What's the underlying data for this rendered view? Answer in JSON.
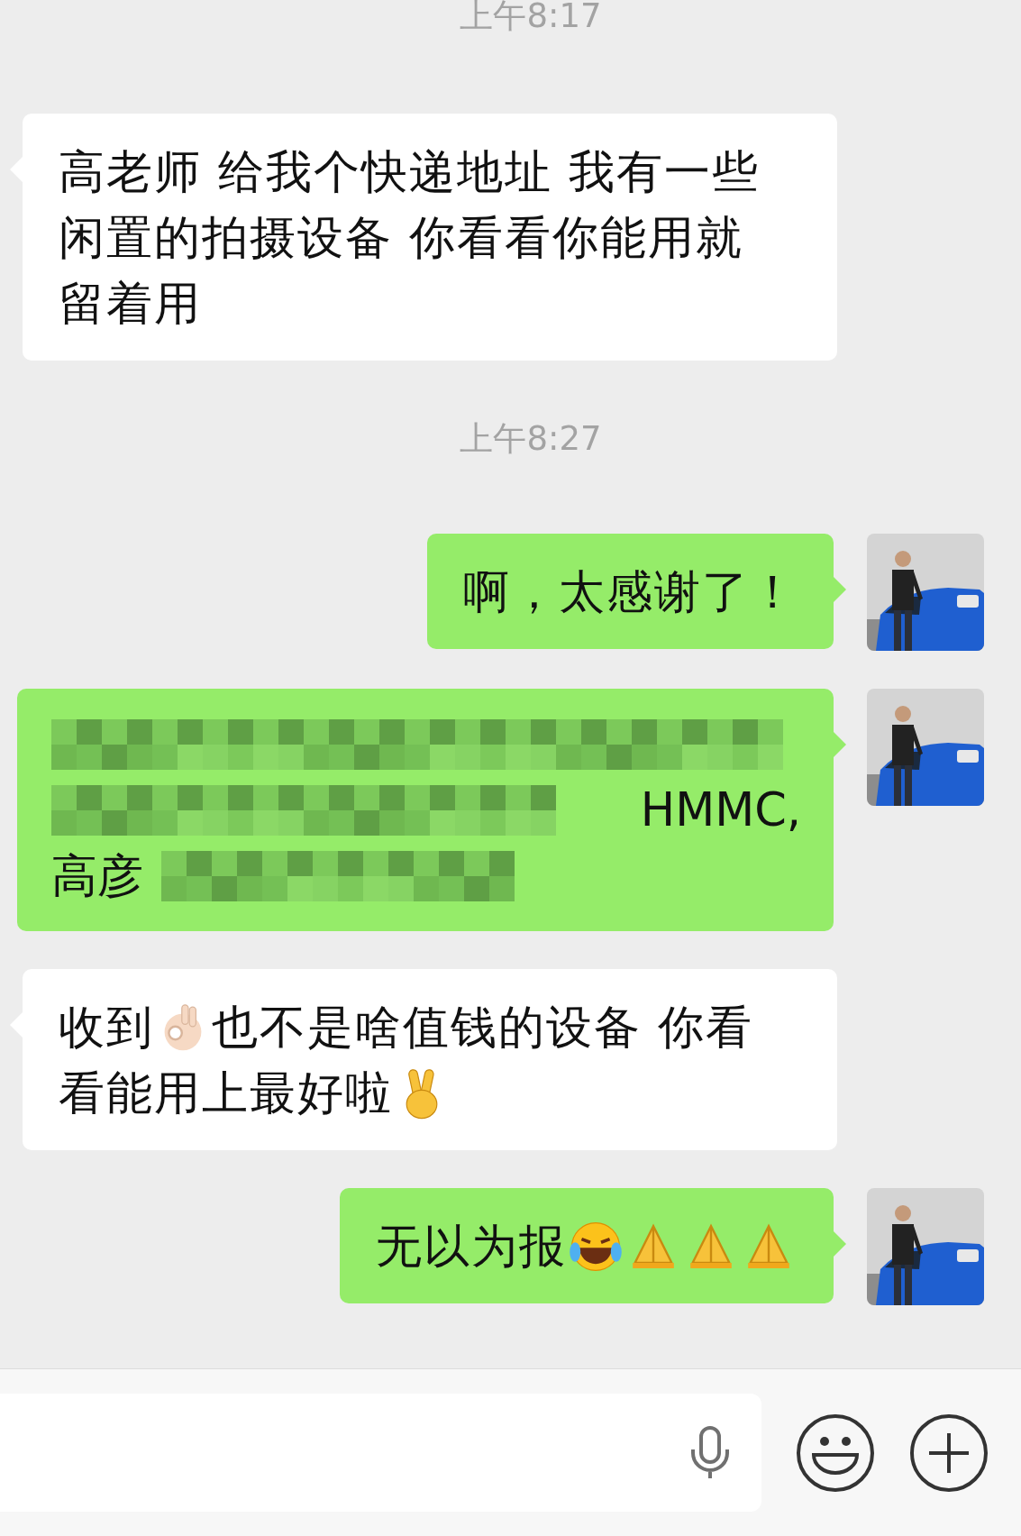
{
  "messages": [
    {
      "kind": "time",
      "text": "上午8:17"
    },
    {
      "kind": "received",
      "lines": [
        [
          {
            "kind": "text",
            "text": "高老师 给我个快递地址 我有一些"
          }
        ],
        [
          {
            "kind": "text",
            "text": "闲置的拍摄设备 你看看你能用就"
          }
        ],
        [
          {
            "kind": "text",
            "text": "留着用"
          }
        ]
      ]
    },
    {
      "kind": "time",
      "text": "上午8:27"
    },
    {
      "kind": "sent",
      "lines": [
        [
          {
            "kind": "text",
            "text": "啊，太感谢了！"
          }
        ]
      ]
    },
    {
      "kind": "redacted",
      "line_2_end": "HMMC,",
      "line_3_start": "高彦"
    },
    {
      "kind": "received",
      "lines": [
        [
          {
            "kind": "text",
            "text": "收到"
          },
          {
            "kind": "ok_hand"
          },
          {
            "kind": "text",
            "text": "也不是啥值钱的设备 你看"
          }
        ],
        [
          {
            "kind": "text",
            "text": "看能用上最好啦"
          },
          {
            "kind": "victory_hand"
          }
        ]
      ]
    },
    {
      "kind": "sent",
      "lines": [
        [
          {
            "kind": "text",
            "text": "无以为报"
          },
          {
            "kind": "laugh_cry"
          },
          {
            "kind": "folded_hands"
          },
          {
            "kind": "folded_hands"
          },
          {
            "kind": "folded_hands"
          }
        ]
      ]
    }
  ]
}
